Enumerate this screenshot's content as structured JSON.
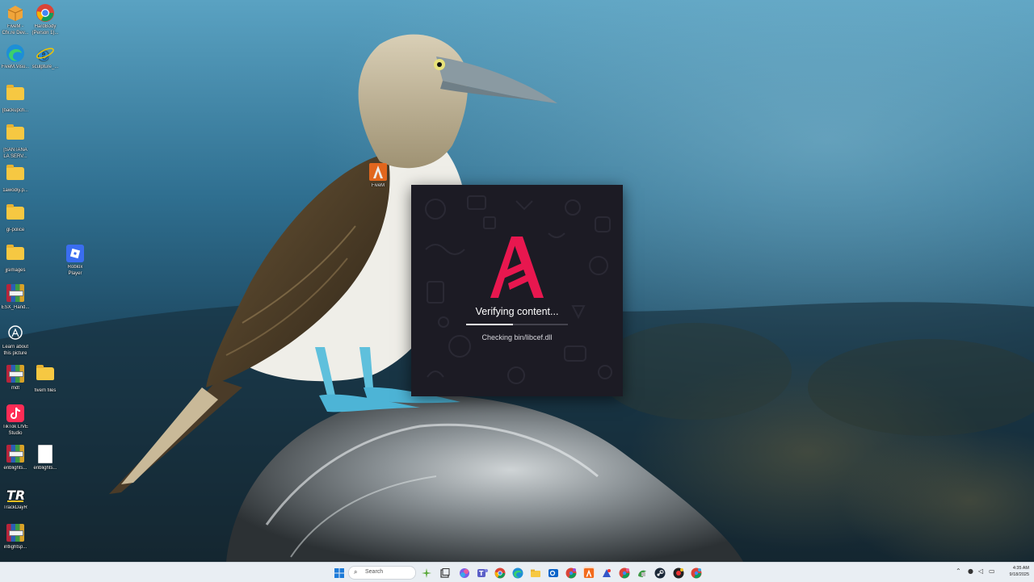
{
  "desktop": {
    "icons": [
      {
        "label": "FiveM -\nCfx.re Dev..."
      },
      {
        "label": "HardBody\n(Person 1)..."
      },
      {
        "label": "FiveM.Visu..."
      },
      {
        "label": "sculpture_..."
      },
      {
        "label": "[backupch..."
      },
      {
        "label": "[SANTANA\nLA SERV..."
      },
      {
        "label": "1awodiy.p..."
      },
      {
        "label": "gl-police"
      },
      {
        "label": "jjsimages"
      },
      {
        "label": "Roblox\nPlayer"
      },
      {
        "label": "ESX_Hand..."
      },
      {
        "label": "Learn about\nthis picture"
      },
      {
        "label": "mdt"
      },
      {
        "label": "fivem files"
      },
      {
        "label": "TikTok LIVE\nStudio"
      },
      {
        "label": "enblights..."
      },
      {
        "label": "enblights..."
      },
      {
        "label": "TrackDayR"
      },
      {
        "label": "intlightsp..."
      },
      {
        "label": "FiveM"
      }
    ]
  },
  "loader": {
    "status": "Verifying content...",
    "detail": "Checking bin/libcef.dll",
    "progress": 0.46,
    "brand_color": "#e8174f",
    "logo_icon": "fivem-logo-icon"
  },
  "taskbar": {
    "search_placeholder": "Search",
    "clock_time": "4:35 AM",
    "clock_date": "9/18/2025",
    "pinned_icons": [
      "start-icon",
      "search-icon",
      "weather-icon",
      "task-view-icon",
      "copilot-icon",
      "teams-icon",
      "chrome-icon",
      "edge-icon",
      "file-explorer-icon",
      "outlook-icon",
      "chrome-profile-icon",
      "fivem-icon",
      "app-icon",
      "chrome-icon-2",
      "app-icon-2",
      "steam-icon",
      "app-icon-3",
      "chrome-icon-3"
    ]
  }
}
